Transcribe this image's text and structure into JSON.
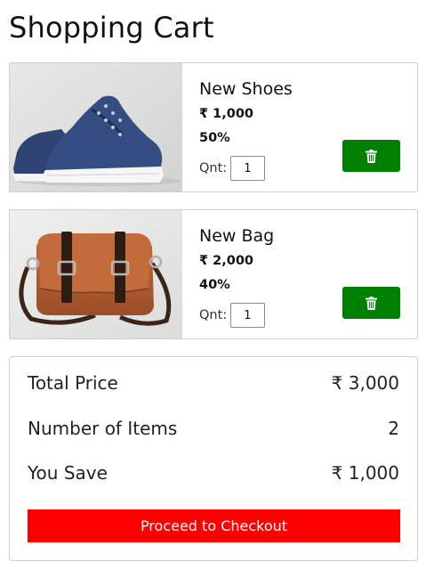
{
  "page": {
    "title": "Shopping Cart"
  },
  "cart": {
    "items": [
      {
        "name": "New Shoes",
        "price": "₹ 1,000",
        "discount": "50%",
        "qty_label": "Qnt:",
        "qty": "1",
        "image": "blue-sneakers-photo",
        "delete_icon": "trash-icon"
      },
      {
        "name": "New Bag",
        "price": "₹ 2,000",
        "discount": "40%",
        "qty_label": "Qnt:",
        "qty": "1",
        "image": "brown-leather-bag-photo",
        "delete_icon": "trash-icon"
      }
    ]
  },
  "summary": {
    "total_price_label": "Total Price",
    "total_price_value": "₹ 3,000",
    "items_label": "Number of Items",
    "items_value": "2",
    "savings_label": "You Save",
    "savings_value": "₹ 1,000",
    "checkout_label": "Proceed to Checkout"
  },
  "colors": {
    "delete_button": "#008000",
    "checkout_button": "#ff0000",
    "border": "#cfcfcf"
  }
}
